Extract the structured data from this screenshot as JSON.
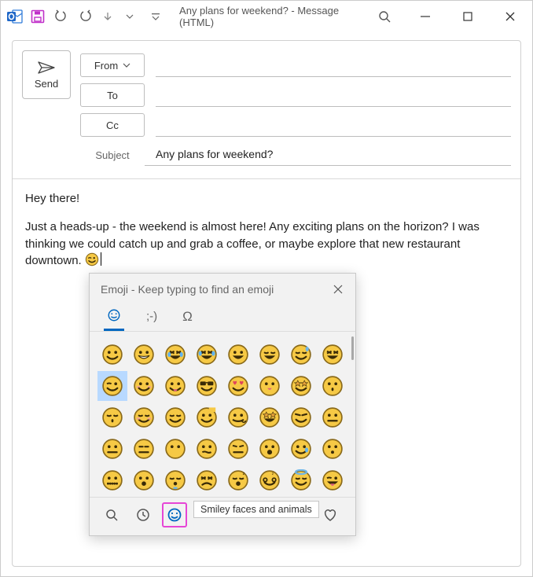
{
  "titlebar": {
    "window_title": "Any plans for weekend?  -  Message (HTML)"
  },
  "compose": {
    "send_label": "Send",
    "from_label": "From",
    "to_label": "To",
    "cc_label": "Cc",
    "subject_label": "Subject",
    "subject_value": "Any plans for weekend?"
  },
  "body": {
    "greeting": "Hey there!",
    "paragraph_prefix": "Just a heads-up - the weekend is almost here! Any exciting plans on the horizon? I was thinking we could catch up and grab a coffee, or maybe explore that new restaurant downtown. "
  },
  "emoji_panel": {
    "title": "Emoji - Keep typing to find an emoji",
    "tab_text": ";-)",
    "tooltip": "Smiley faces and animals",
    "selected_index": 8,
    "grid_count": 40
  },
  "colors": {
    "accent": "#0067c0",
    "magenta": "#e646d6",
    "emoji_face": "#f6c945",
    "emoji_stroke": "#8a6a1a"
  }
}
